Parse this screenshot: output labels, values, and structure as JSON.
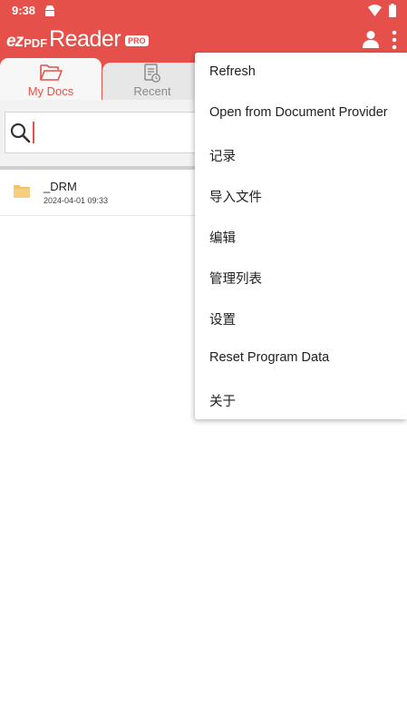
{
  "status_bar": {
    "time": "9:38",
    "icons": [
      "android-icon",
      "wifi-icon",
      "battery-icon"
    ]
  },
  "app_bar": {
    "logo": {
      "ez": "ez",
      "pdf": "PDF",
      "reader": "Reader",
      "badge": "PRO"
    },
    "icons": [
      "user-icon",
      "more-vert-icon"
    ],
    "color": "#e5514a"
  },
  "tabs": [
    {
      "label": "My Docs",
      "icon": "folder-open-icon",
      "selected": true
    },
    {
      "label": "Recent",
      "icon": "recent-document-icon",
      "selected": false
    }
  ],
  "search": {
    "value": "",
    "placeholder": ""
  },
  "files": [
    {
      "name": "_DRM",
      "date": "2024-04-01 09:33",
      "icon": "folder-icon"
    }
  ],
  "menu": {
    "items": [
      {
        "label": "Refresh"
      },
      {
        "label": "Open from Document Provider"
      },
      {
        "label": "记录"
      },
      {
        "label": "导入文件"
      },
      {
        "label": "编辑"
      },
      {
        "label": "管理列表"
      },
      {
        "label": "设置"
      },
      {
        "label": "Reset Program Data"
      },
      {
        "label": "关于"
      }
    ]
  },
  "colors": {
    "accent": "#e5514a",
    "folder": "#f0c36a"
  }
}
